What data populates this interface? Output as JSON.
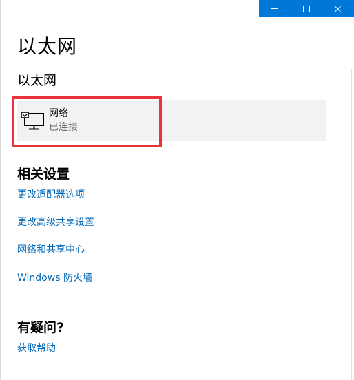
{
  "window": {
    "caption_color": "#0078d7",
    "controls": {
      "minimize": "minimize-icon",
      "maximize": "maximize-icon",
      "close": "close-icon"
    }
  },
  "page": {
    "title": "以太网",
    "section_heading": "以太网"
  },
  "network": {
    "icon": "ethernet-monitor-icon",
    "name": "网络",
    "status": "已连接"
  },
  "highlight_color": "#e8323c",
  "related": {
    "heading": "相关设置",
    "links": [
      "更改适配器选项",
      "更改高级共享设置",
      "网络和共享中心",
      "Windows 防火墙"
    ],
    "link_color": "#0067b8"
  },
  "help": {
    "heading": "有疑问?",
    "link": "获取帮助"
  }
}
